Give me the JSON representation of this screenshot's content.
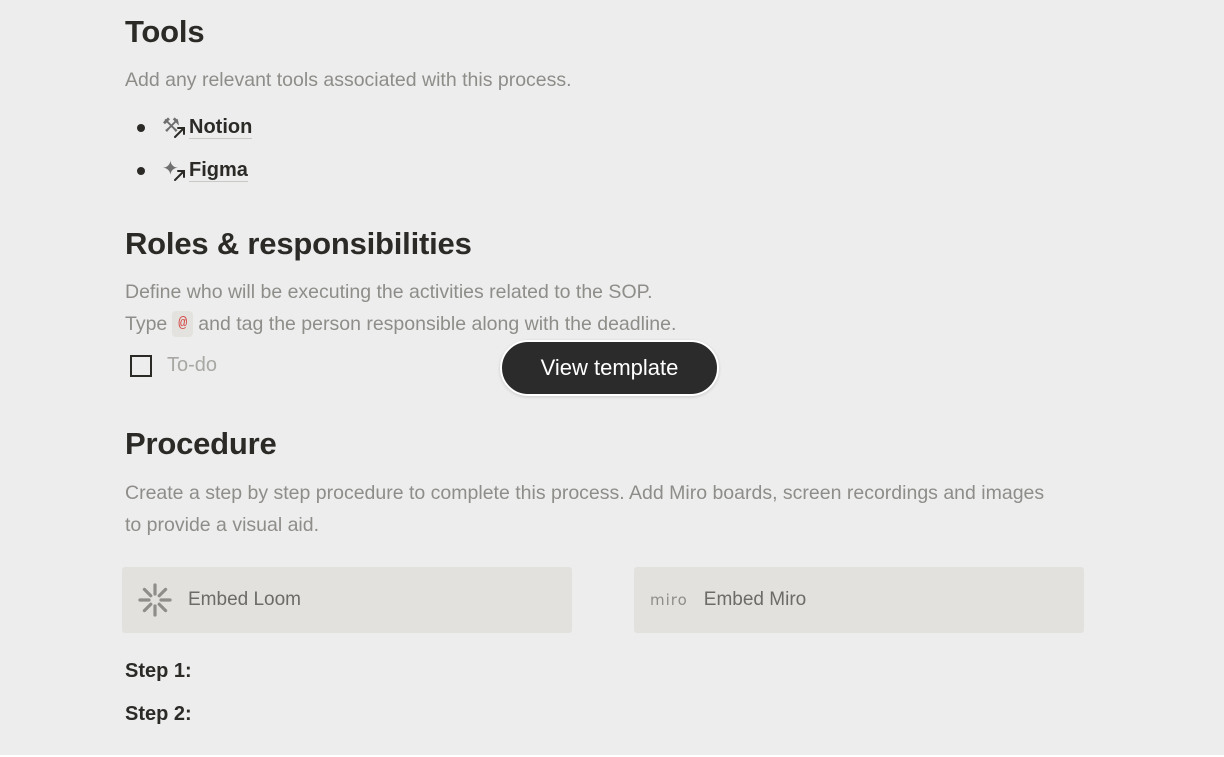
{
  "tools": {
    "title": "Tools",
    "description": "Add any relevant tools associated with this process.",
    "items": [
      {
        "icon": "hammer-and-wrench-icon",
        "glyph": "⚒",
        "label": "Notion"
      },
      {
        "icon": "satellite-icon",
        "glyph": "✦",
        "label": "Figma"
      }
    ]
  },
  "roles": {
    "title": "Roles & responsibilities",
    "description_line1": "Define who will be executing the activities related to the SOP.",
    "description_line2_prefix": "Type",
    "code_chip": "@",
    "description_line2_suffix": "and tag the person responsible along with the deadline.",
    "todo_placeholder": "To-do"
  },
  "view_template_button": "View template",
  "procedure": {
    "title": "Procedure",
    "description": "Create a step by step procedure to complete this process. Add Miro boards, screen recordings and images to provide a visual aid.",
    "embed_loom": "Embed Loom",
    "embed_miro_logo": "miro",
    "embed_miro": "Embed Miro",
    "steps": [
      "Step 1:",
      "Step 2:"
    ]
  }
}
